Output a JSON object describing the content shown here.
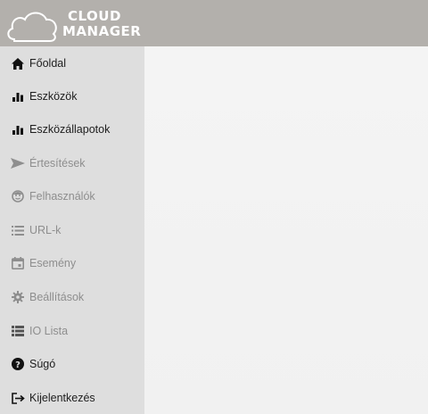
{
  "app": {
    "logo_line1": "CLOUD",
    "logo_line2": "MANAGER"
  },
  "sidebar": {
    "items": [
      {
        "label": "Főoldal",
        "icon": "home-icon",
        "muted": false
      },
      {
        "label": "Eszközök",
        "icon": "bar-chart-icon",
        "muted": false
      },
      {
        "label": "Eszközállapotok",
        "icon": "bar-chart-icon",
        "muted": false
      },
      {
        "label": "Értesítések",
        "icon": "send-icon",
        "muted": true
      },
      {
        "label": "Felhasználók",
        "icon": "user-face-icon",
        "muted": true
      },
      {
        "label": "URL-k",
        "icon": "list-icon",
        "muted": true
      },
      {
        "label": "Esemény",
        "icon": "calendar-icon",
        "muted": true
      },
      {
        "label": "Beállítások",
        "icon": "gear-icon",
        "muted": true
      },
      {
        "label": "IO Lista",
        "icon": "list-bold-icon",
        "muted": true
      },
      {
        "label": "Súgó",
        "icon": "help-icon",
        "muted": false
      },
      {
        "label": "Kijelentkezés",
        "icon": "logout-icon",
        "muted": false
      }
    ]
  },
  "colors": {
    "topbar": "#b3b0ac",
    "sidebar": "#dedede",
    "main": "#f2f2f2",
    "text": "#1e1e1e",
    "muted_text": "#8e8e8e"
  }
}
